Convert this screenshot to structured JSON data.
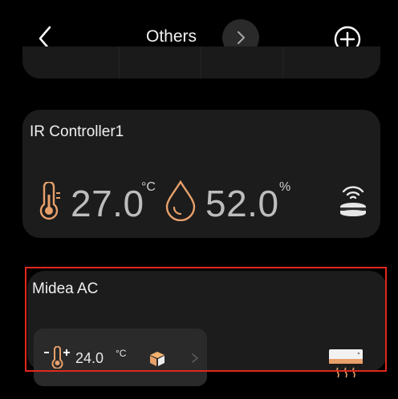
{
  "header": {
    "title": "Others",
    "back_icon": "chevron-left-icon",
    "title_menu_icon": "chevron-right-icon",
    "add_icon": "plus-circle-icon"
  },
  "devices": [
    {
      "name": "IR Controller1",
      "temperature": {
        "value": "27.0",
        "unit": "°C",
        "icon": "thermometer-icon"
      },
      "humidity": {
        "value": "52.0",
        "unit": "%",
        "icon": "water-drop-icon"
      },
      "device_icon": "ir-blaster-icon"
    },
    {
      "name": "Midea AC",
      "setpoint": {
        "value": "24.0",
        "unit": "°C",
        "icon": "thermometer-setpoint-icon"
      },
      "mode_icon": "cube-icon",
      "device_icon": "air-conditioner-icon",
      "highlighted": true
    }
  ],
  "colors": {
    "accent": "#e8a06a",
    "highlight_border": "#e0281c",
    "card_bg": "#1c1c1c"
  }
}
